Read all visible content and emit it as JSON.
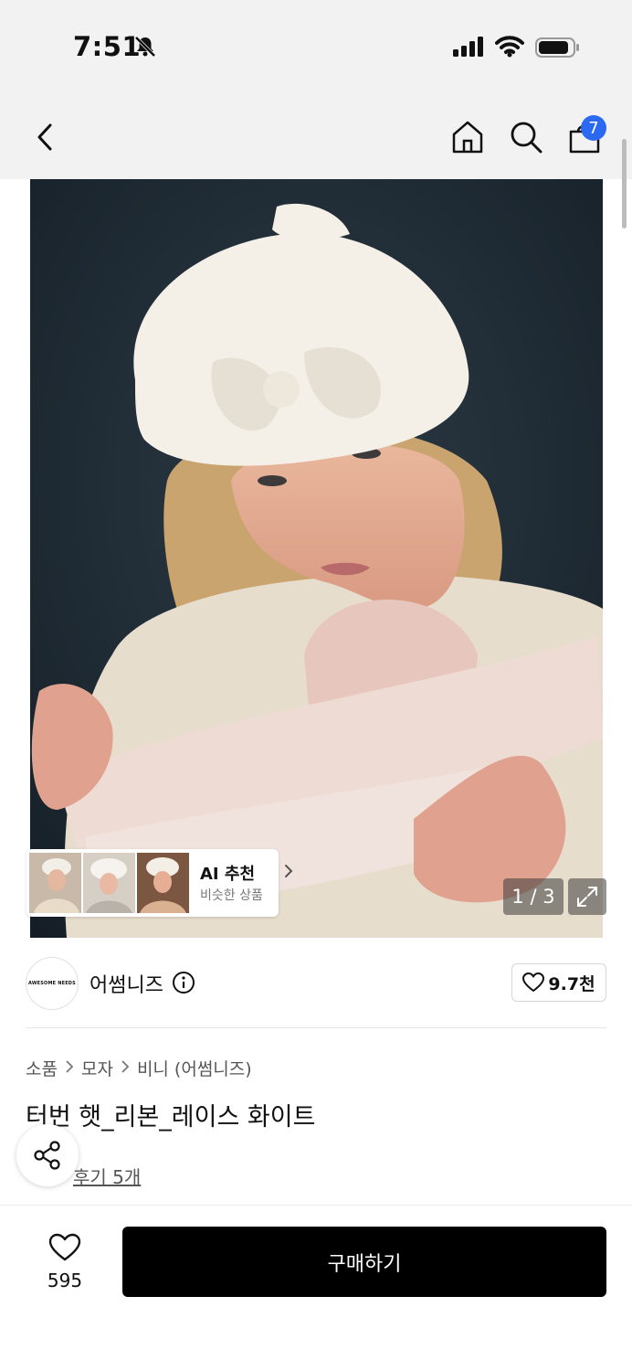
{
  "status_bar": {
    "time": "7:51"
  },
  "nav": {
    "cart_count": "7"
  },
  "gallery": {
    "counter": "1 / 3",
    "ai_recommend": {
      "title": "AI 추천",
      "subtitle": "비슷한 상품"
    }
  },
  "brand": {
    "logo_text": "AWESOME NEEDS",
    "name": "어썸니즈",
    "likes": "9.7천"
  },
  "breadcrumb": [
    "소품",
    "모자",
    "비니 (어썸니즈)"
  ],
  "product": {
    "title": "터번 햇_리본_레이스 화이트",
    "reviews_label": "후기 5개"
  },
  "bottom_bar": {
    "wish_count": "595",
    "buy_label": "구매하기"
  },
  "colors": {
    "accent_badge": "#2b6af0",
    "buy_button": "#000000"
  }
}
